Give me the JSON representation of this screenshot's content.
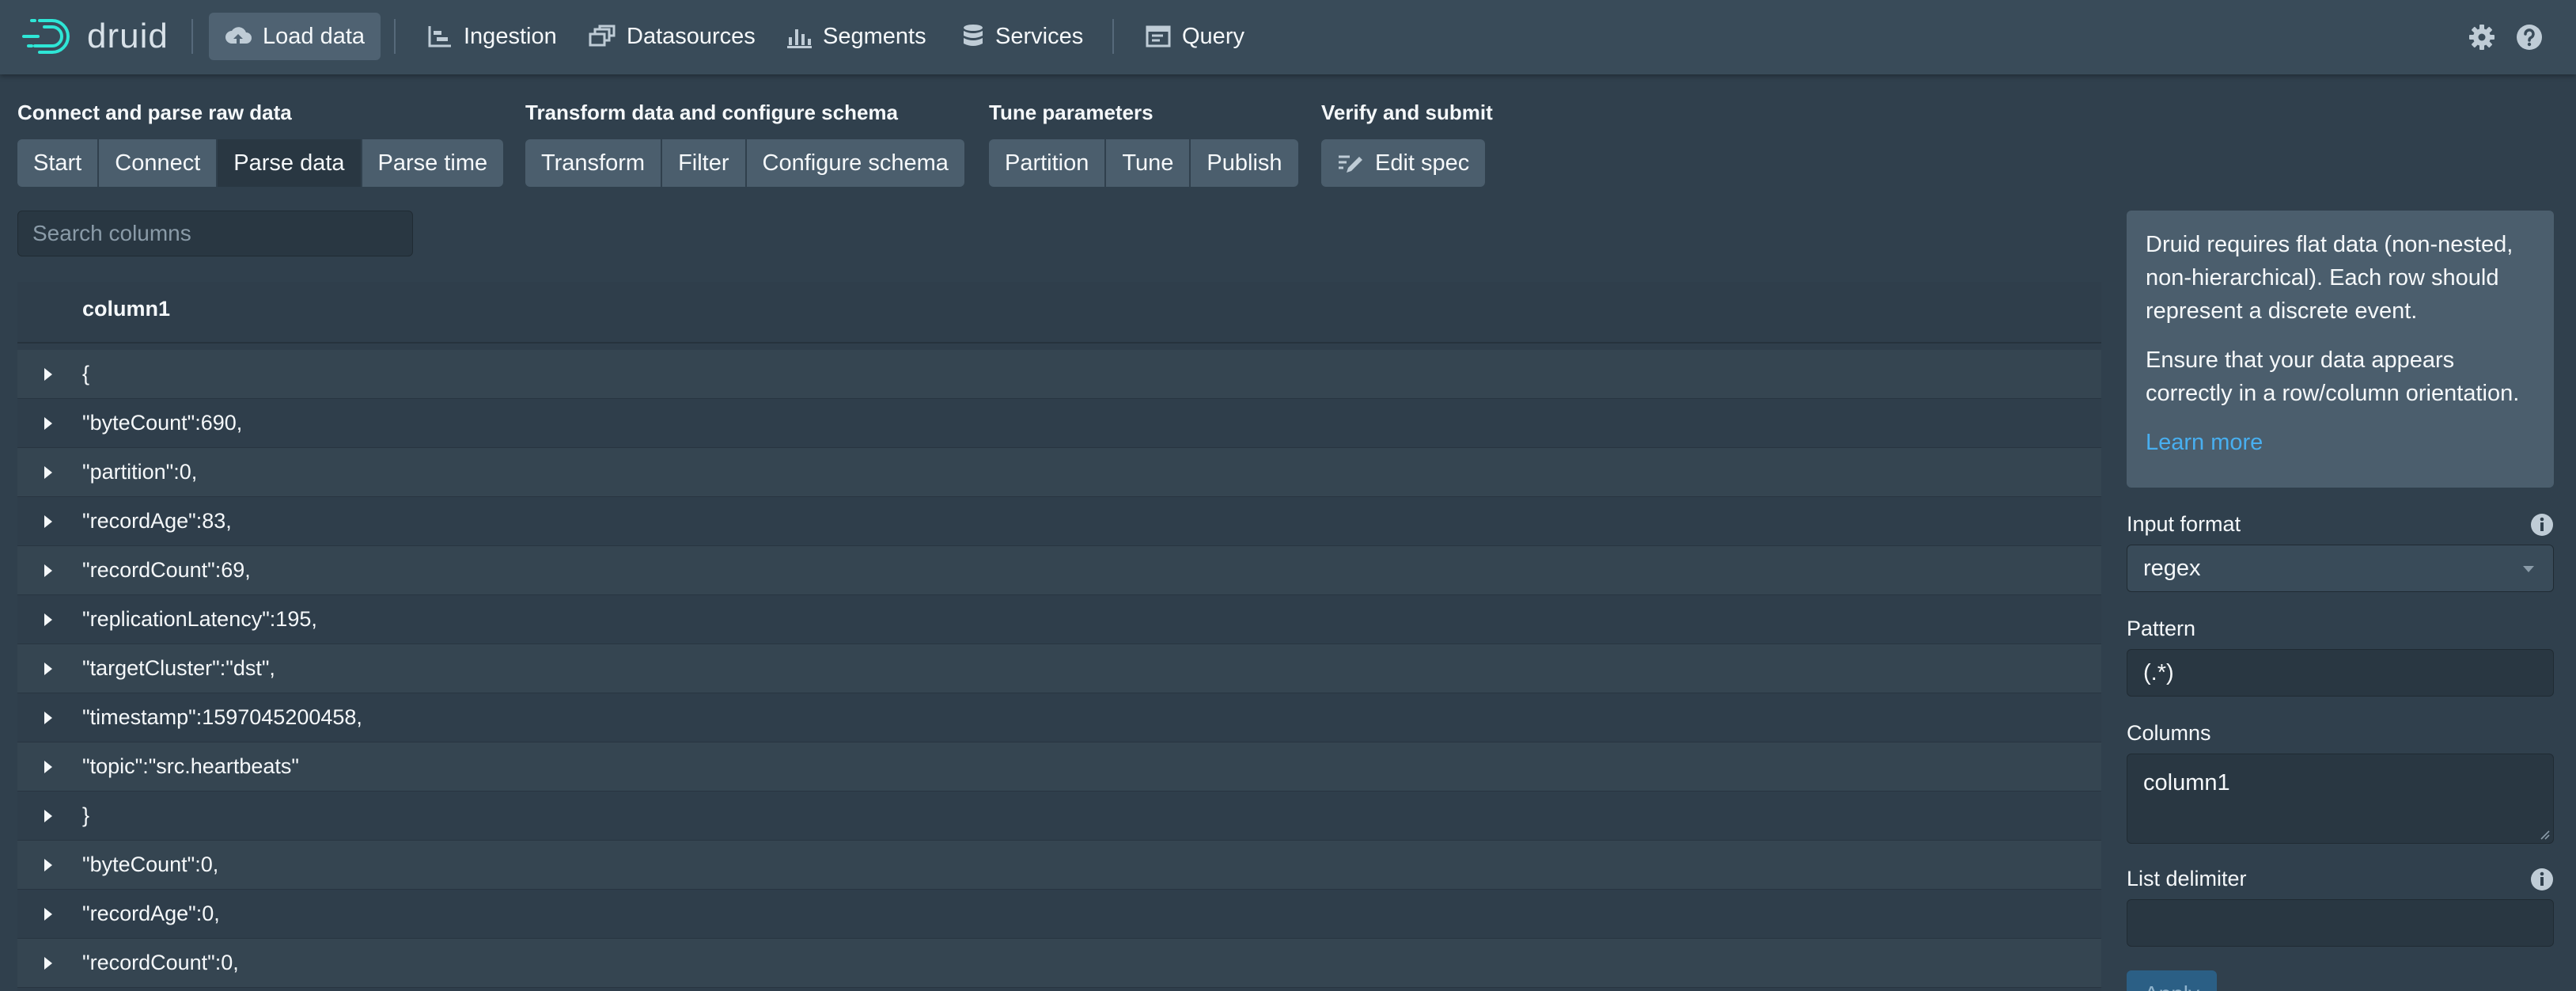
{
  "app": {
    "name": "druid"
  },
  "nav": {
    "load_data": "Load data",
    "ingestion": "Ingestion",
    "datasources": "Datasources",
    "segments": "Segments",
    "services": "Services",
    "query": "Query"
  },
  "steps": {
    "connect_title": "Connect and parse raw data",
    "connect": [
      "Start",
      "Connect",
      "Parse data",
      "Parse time"
    ],
    "transform_title": "Transform data and configure schema",
    "transform": [
      "Transform",
      "Filter",
      "Configure schema"
    ],
    "tune_title": "Tune parameters",
    "tune": [
      "Partition",
      "Tune",
      "Publish"
    ],
    "verify_title": "Verify and submit",
    "edit_spec": "Edit spec"
  },
  "search": {
    "placeholder": "Search columns"
  },
  "table": {
    "header": "column1",
    "rows": [
      "{",
      "\"byteCount\":690,",
      "\"partition\":0,",
      "\"recordAge\":83,",
      "\"recordCount\":69,",
      "\"replicationLatency\":195,",
      "\"targetCluster\":\"dst\",",
      "\"timestamp\":1597045200458,",
      "\"topic\":\"src.heartbeats\"",
      "}",
      "\"byteCount\":0,",
      "\"recordAge\":0,",
      "\"recordCount\":0,"
    ]
  },
  "panel": {
    "info_p1": "Druid requires flat data (non-nested, non-hierarchical). Each row should represent a discrete event.",
    "info_p2": "Ensure that your data appears correctly in a row/column orientation.",
    "learn_more": "Learn more",
    "input_format_label": "Input format",
    "input_format_value": "regex",
    "pattern_label": "Pattern",
    "pattern_value": "(.*)",
    "columns_label": "Columns",
    "columns_value": "column1",
    "list_delimiter_label": "List delimiter",
    "list_delimiter_value": "",
    "apply": "Apply"
  },
  "colors": {
    "accent_link": "#48aff0",
    "navbar": "#394b59",
    "background": "#30404d"
  }
}
